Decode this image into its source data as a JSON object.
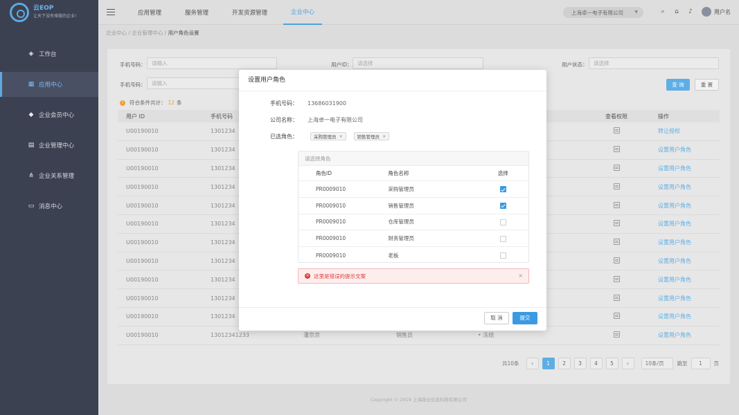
{
  "app": {
    "logo_main": "云EOP",
    "logo_sub": "让天下没有难做的企业!"
  },
  "sidebar": {
    "items": [
      {
        "label": "工作台",
        "icon": "layers-icon"
      },
      {
        "label": "应用中心",
        "icon": "grid-icon",
        "active": true
      },
      {
        "label": "企业会员中心",
        "icon": "diamond-icon"
      },
      {
        "label": "企业管理中心",
        "icon": "document-icon"
      },
      {
        "label": "企业关系管理",
        "icon": "share-icon"
      },
      {
        "label": "消息中心",
        "icon": "message-icon"
      }
    ]
  },
  "topbar": {
    "tabs": [
      "应用管理",
      "服务管理",
      "开发资源管理",
      "企业中心"
    ],
    "active_tab": "企业中心",
    "company": "上海卓一电子有限公司",
    "username": "用户名"
  },
  "breadcrumb": [
    "企业中心",
    "企业管理中心",
    "用户角色设置"
  ],
  "filters": {
    "phone1_label": "手机号码：",
    "phone1_placeholder": "请输入",
    "userid_label": "用户ID：",
    "userid_placeholder": "请选择",
    "status_label": "用户状态：",
    "status_placeholder": "请选择",
    "phone2_label": "手机号码：",
    "phone2_placeholder": "请输入",
    "query_btn": "查 询",
    "reset_btn": "重 置"
  },
  "result": {
    "prefix": "符合条件共计：",
    "count": "12",
    "suffix": "条"
  },
  "table": {
    "headers": [
      "用户 ID",
      "手机号码",
      "",
      "",
      "",
      "查看权限",
      "操作"
    ],
    "rows": [
      {
        "id": "U00190010",
        "phone": "1301234",
        "name": "",
        "role": "",
        "status": "",
        "action": "转让授权"
      },
      {
        "id": "U00190010",
        "phone": "1301234",
        "name": "",
        "role": "",
        "status": "",
        "action": "设置用户角色"
      },
      {
        "id": "U00190010",
        "phone": "1301234",
        "name": "",
        "role": "",
        "status": "",
        "action": "设置用户角色"
      },
      {
        "id": "U00190010",
        "phone": "1301234",
        "name": "",
        "role": "",
        "status": "",
        "action": "设置用户角色"
      },
      {
        "id": "U00190010",
        "phone": "1301234",
        "name": "",
        "role": "",
        "status": "",
        "action": "设置用户角色"
      },
      {
        "id": "U00190010",
        "phone": "1301234",
        "name": "",
        "role": "",
        "status": "",
        "action": "设置用户角色"
      },
      {
        "id": "U00190010",
        "phone": "1301234",
        "name": "",
        "role": "",
        "status": "",
        "action": "设置用户角色"
      },
      {
        "id": "U00190010",
        "phone": "1301234",
        "name": "",
        "role": "",
        "status": "",
        "action": "设置用户角色"
      },
      {
        "id": "U00190010",
        "phone": "1301234",
        "name": "",
        "role": "",
        "status": "",
        "action": "设置用户角色"
      },
      {
        "id": "U00190010",
        "phone": "1301234",
        "name": "",
        "role": "",
        "status": "",
        "action": "设置用户角色"
      },
      {
        "id": "U00190010",
        "phone": "1301234",
        "name": "",
        "role": "",
        "status": "",
        "action": "设置用户角色"
      },
      {
        "id": "U00190010",
        "phone": "13012341233",
        "name": "潘京京",
        "role": "销售员",
        "status": "• 冻结",
        "action": "设置用户角色"
      }
    ]
  },
  "pagination": {
    "total": "共10条",
    "pages": [
      "1",
      "2",
      "3",
      "4",
      "5"
    ],
    "prev": "‹",
    "next": "›",
    "size": "10条/页",
    "goto_label": "跳至",
    "goto_value": "1",
    "page_suffix": "页"
  },
  "modal": {
    "title": "设置用户角色",
    "phone_label": "手机号码：",
    "phone_value": "13686031900",
    "company_label": "公司名称：",
    "company_value": "上海卓一电子有限公司",
    "selected_label": "已选角色：",
    "selected_tags": [
      "采购管理员",
      "销售管理员"
    ],
    "role_box_title": "请选择角色",
    "role_headers": [
      "角色ID",
      "角色名称",
      "选择"
    ],
    "roles": [
      {
        "id": "PR0009010",
        "name": "采购管理员",
        "checked": true
      },
      {
        "id": "PR0009010",
        "name": "销售管理员",
        "checked": true
      },
      {
        "id": "PR0009010",
        "name": "仓库管理员",
        "checked": false
      },
      {
        "id": "PR0009010",
        "name": "财务管理员",
        "checked": false
      },
      {
        "id": "PR0009010",
        "name": "老板",
        "checked": false
      }
    ],
    "error_text": "这里是错误的提示文案",
    "cancel": "取 消",
    "submit": "提交"
  },
  "footer": "Copyright © 2019 上海奔云信息科技有限公司",
  "colors": {
    "accent": "#5eaee6",
    "sidebar": "#3c4152",
    "error": "#e04040",
    "warning": "#f0a030"
  }
}
